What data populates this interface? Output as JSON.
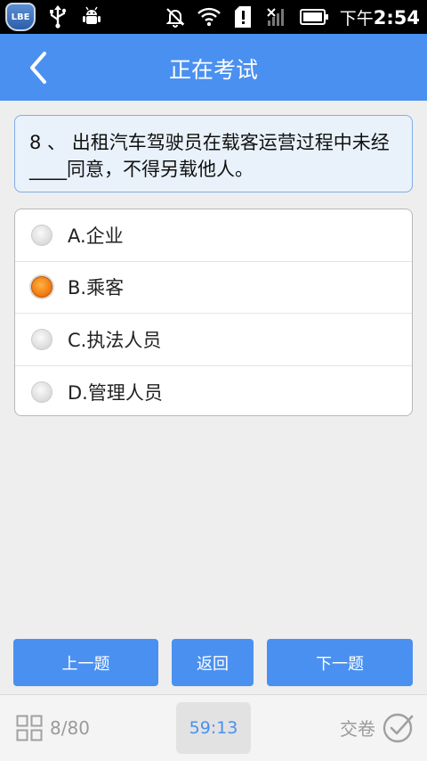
{
  "status_bar": {
    "badge_text": "LBE",
    "time_prefix": "下午",
    "time": "2:54",
    "icons": [
      "lbe-badge-icon",
      "usb-icon",
      "android-debug-icon",
      "notifications-off-icon",
      "wifi-icon",
      "sd-card-alert-icon",
      "no-signal-icon",
      "battery-icon"
    ]
  },
  "header": {
    "title": "正在考试",
    "back_icon": "chevron-left-icon"
  },
  "question": {
    "text": "8 、 出租汽车驾驶员在载客运营过程中未经____同意，不得另载他人。"
  },
  "options": [
    {
      "label": "A.企业",
      "selected": false
    },
    {
      "label": "B.乘客",
      "selected": true
    },
    {
      "label": "C.执法人员",
      "selected": false
    },
    {
      "label": "D.管理人员",
      "selected": false
    }
  ],
  "buttons": {
    "prev": "上一题",
    "back": "返回",
    "next": "下一题"
  },
  "bottom": {
    "progress": "8/80",
    "timer": "59:13",
    "submit": "交卷",
    "grid_icon": "grid-icon",
    "check_icon": "check-circle-icon"
  },
  "colors": {
    "accent": "#4a90f0",
    "selected_radio": "#f07a10"
  }
}
